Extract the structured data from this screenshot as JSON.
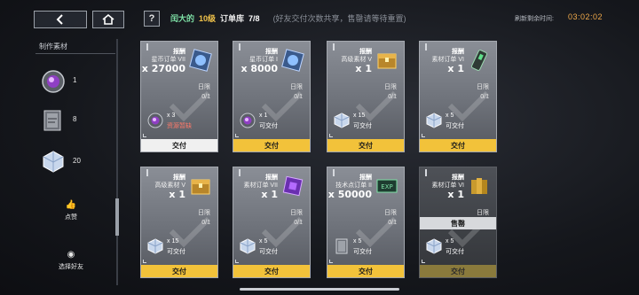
{
  "header": {
    "owner": "闰大的",
    "level": "10级",
    "title": "订单库",
    "count": "7/8",
    "note": "(好友交付次数共享，售罄请等待重置)",
    "refresh_label": "刷新剩余时间:",
    "refresh_timer": "03:02:02",
    "help": "?"
  },
  "sidebar": {
    "section_label": "制作素材",
    "materials": [
      {
        "icon": "purple-orb-icon",
        "count": "1"
      },
      {
        "icon": "book-icon",
        "count": "8"
      },
      {
        "icon": "crystal-cube-icon",
        "count": "20"
      }
    ],
    "like_label": "点赞",
    "select_friend_label": "选择好友"
  },
  "cards": [
    {
      "label": "报酬",
      "name": "星币订单 VII",
      "qty": "x 27000",
      "icon": "blue-gem-icon",
      "limit_label": "日限",
      "limit": "0/1",
      "cost_icon": "purple-orb-icon",
      "cost_qty": "x 3",
      "cost_status": "资源暂缺",
      "warn": true,
      "action": "交付",
      "disabled": true
    },
    {
      "label": "报酬",
      "name": "星币订单 I",
      "qty": "x 8000",
      "icon": "blue-gem-icon",
      "limit_label": "日限",
      "limit": "0/1",
      "cost_icon": "purple-orb-icon",
      "cost_qty": "x 1",
      "cost_status": "可交付",
      "warn": false,
      "action": "交付",
      "disabled": false
    },
    {
      "label": "报酬",
      "name": "高级素材 V",
      "qty": "x 1",
      "icon": "gold-chest-icon",
      "limit_label": "日限",
      "limit": "0/1",
      "cost_icon": "crystal-cube-icon",
      "cost_qty": "x 15",
      "cost_status": "可交付",
      "warn": false,
      "action": "交付",
      "disabled": false
    },
    {
      "label": "报酬",
      "name": "素材订单 VI",
      "qty": "x 1",
      "icon": "green-device-icon",
      "limit_label": "日限",
      "limit": "0/1",
      "cost_icon": "crystal-cube-icon",
      "cost_qty": "x 5",
      "cost_status": "可交付",
      "warn": false,
      "action": "交付",
      "disabled": false
    },
    {
      "label": "报酬",
      "name": "高级素材 V",
      "qty": "x 1",
      "icon": "gold-chest-icon",
      "limit_label": "日限",
      "limit": "0/1",
      "cost_icon": "crystal-cube-icon",
      "cost_qty": "x 15",
      "cost_status": "可交付",
      "warn": false,
      "action": "交付",
      "disabled": false
    },
    {
      "label": "报酬",
      "name": "素材订单 VII",
      "qty": "x 1",
      "icon": "purple-box-icon",
      "limit_label": "日限",
      "limit": "0/1",
      "cost_icon": "crystal-cube-icon",
      "cost_qty": "x 5",
      "cost_status": "可交付",
      "warn": false,
      "action": "交付",
      "disabled": false
    },
    {
      "label": "报酬",
      "name": "技术点订单 II",
      "qty": "x 50000",
      "icon": "exp-card-icon",
      "limit_label": "日限",
      "limit": "0/1",
      "cost_icon": "book-icon",
      "cost_qty": "x 5",
      "cost_status": "可交付",
      "warn": false,
      "action": "交付",
      "disabled": false
    },
    {
      "label": "报酬",
      "name": "素材订单 VI",
      "qty": "x 1",
      "icon": "gold-bars-icon",
      "limit_label": "日限",
      "limit": "0/1",
      "cost_icon": "crystal-cube-icon",
      "cost_qty": "x 5",
      "cost_status": "可交付",
      "warn": false,
      "action": "交付",
      "disabled": true,
      "sold": true,
      "sold_label": "售罄"
    }
  ]
}
